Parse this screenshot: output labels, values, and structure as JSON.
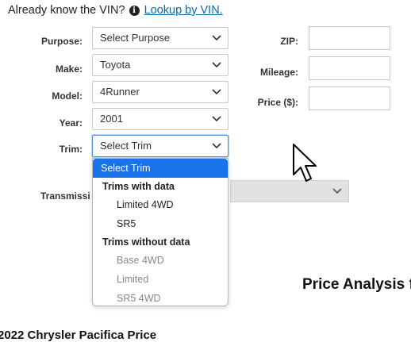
{
  "intro": {
    "text": "Already know the VIN?",
    "link": "Lookup by VIN."
  },
  "form": {
    "purpose": {
      "label": "Purpose:",
      "value": "Select Purpose"
    },
    "make": {
      "label": "Make:",
      "value": "Toyota"
    },
    "model": {
      "label": "Model:",
      "value": "4Runner"
    },
    "year": {
      "label": "Year:",
      "value": "2001"
    },
    "trim": {
      "label": "Trim:",
      "value": "Select Trim"
    },
    "transmission": {
      "label": "Transmissi"
    },
    "zip": {
      "label": "ZIP:",
      "value": ""
    },
    "mileage": {
      "label": "Mileage:",
      "value": ""
    },
    "price": {
      "label": "Price ($):",
      "value": ""
    }
  },
  "trim_dropdown": {
    "selected": "Select Trim",
    "group_with_data": "Trims with data",
    "with_data": [
      "Limited 4WD",
      "SR5"
    ],
    "group_without_data": "Trims without data",
    "without_data": [
      "Base 4WD",
      "Limited",
      "SR5 4WD"
    ]
  },
  "price_heading": "Price Analysis f",
  "bottom_heading": "2022 Chrysler Pacifica Price",
  "icons": {
    "info": "info-circle-icon",
    "chevron": "chevron-down-icon",
    "cursor": "mouse-pointer-icon"
  },
  "colors": {
    "link": "#0a6aa8",
    "dropdown_highlight": "#1a73e8"
  }
}
